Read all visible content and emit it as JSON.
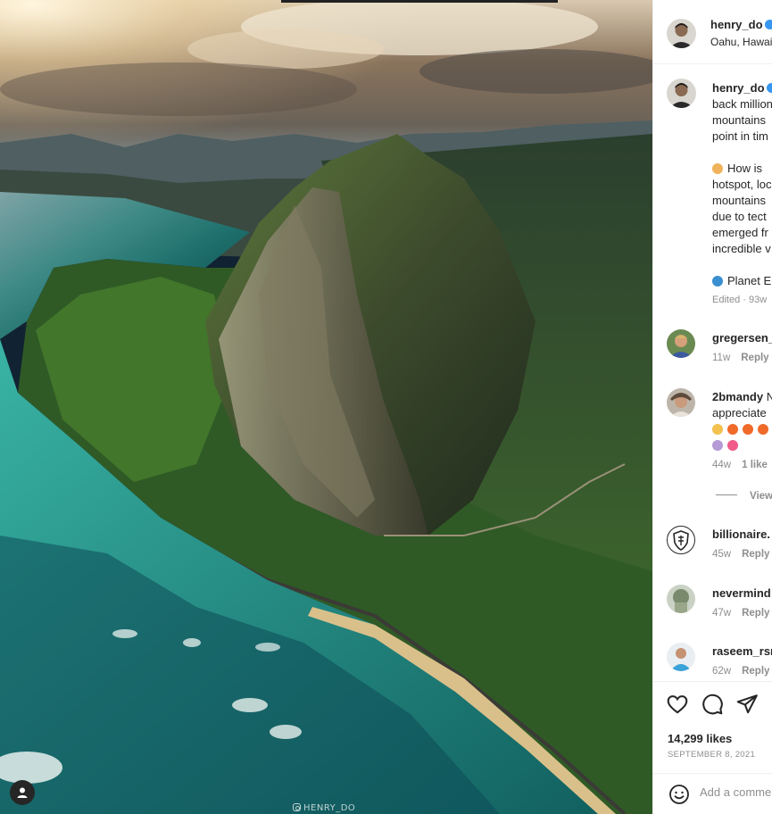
{
  "post": {
    "username": "henry_do",
    "location": "Oahu, Hawaii",
    "watermark": "HENRY_DO"
  },
  "caption": {
    "username": "henry_do",
    "lines": [
      "back million",
      "mountains",
      "point in tim"
    ],
    "para2": [
      "How is",
      "hotspot, loc",
      "mountains",
      "due to tect",
      "emerged fr",
      "incredible v"
    ],
    "para3": "Planet E",
    "meta": "Edited · 93w"
  },
  "comments": [
    {
      "username": "gregersen_",
      "text": "",
      "time": "11w",
      "reply": "Reply",
      "likes": ""
    },
    {
      "username": "2bmandy",
      "text": "N",
      "line2": "appreciate",
      "line3_emoji": [
        "clap-emoji",
        "fire-emoji",
        "fire-emoji",
        "fire-emoji"
      ],
      "line4_emoji": [
        "person-emoji",
        "heart-emoji"
      ],
      "time": "44w",
      "likes": "1 like",
      "reply": ""
    },
    {
      "username": "billionaire.",
      "text": "",
      "time": "45w",
      "reply": "Reply"
    },
    {
      "username": "nevermind",
      "text": "",
      "time": "47w",
      "reply": "Reply"
    },
    {
      "username": "raseem_rsn",
      "text": "",
      "time": "62w",
      "reply": "Reply"
    }
  ],
  "view_replies": "View",
  "actions": {
    "likes": "14,299 likes",
    "date": "SEPTEMBER 8, 2021",
    "comment_placeholder": "Add a comment..."
  },
  "colors": {
    "verified": "#3897f0",
    "muted": "#8e8e8e",
    "text": "#262626"
  }
}
